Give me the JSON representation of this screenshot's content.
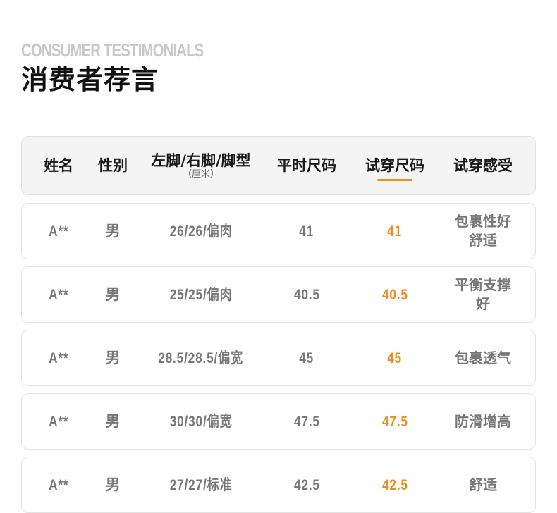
{
  "hero": {
    "eyebrow": "CONSUMER TESTIMONIALS",
    "title": "消费者荐言"
  },
  "table": {
    "headers": {
      "name": "姓名",
      "gender": "性别",
      "foot": "左脚/右脚/脚型",
      "foot_unit": "（厘米）",
      "usual_size": "平时尺码",
      "trial_size": "试穿尺码",
      "feel": "试穿感受"
    },
    "rows": [
      {
        "name": "A**",
        "gender": "男",
        "foot": "26/26/偏肉",
        "usual": "41",
        "trial": "41",
        "feel": "包裹性好舒适"
      },
      {
        "name": "A**",
        "gender": "男",
        "foot": "25/25/偏肉",
        "usual": "40.5",
        "trial": "40.5",
        "feel": "平衡支撑好"
      },
      {
        "name": "A**",
        "gender": "男",
        "foot": "28.5/28.5/偏宽",
        "usual": "45",
        "trial": "45",
        "feel": "包裹透气"
      },
      {
        "name": "A**",
        "gender": "男",
        "foot": "30/30/偏宽",
        "usual": "47.5",
        "trial": "47.5",
        "feel": "防滑增高"
      },
      {
        "name": "A**",
        "gender": "男",
        "foot": "27/27/标准",
        "usual": "42.5",
        "trial": "42.5",
        "feel": "舒适"
      }
    ]
  },
  "colors": {
    "accent": "#f08c1e",
    "muted_text": "#777777",
    "header_bg": "#f4f4f4"
  }
}
